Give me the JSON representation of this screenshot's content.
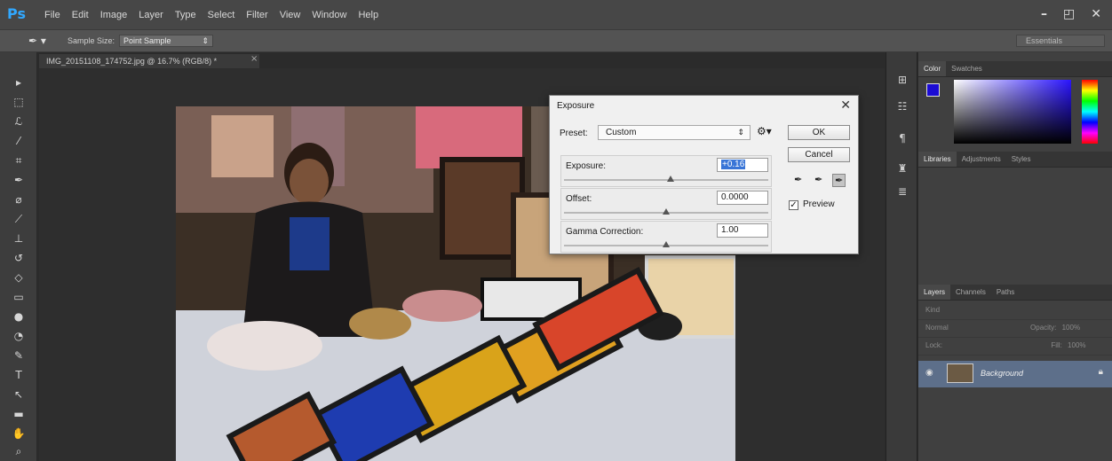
{
  "app": {
    "logo": "Ps",
    "menus": [
      "File",
      "Edit",
      "Image",
      "Layer",
      "Type",
      "Select",
      "Filter",
      "View",
      "Window",
      "Help"
    ],
    "window_controls": [
      "–",
      "◰",
      "✕"
    ]
  },
  "options_bar": {
    "tool_icon": "eyedropper-icon",
    "sample_size_label": "Sample Size:",
    "sample_size_value": "Point Sample",
    "workspace": "Essentials"
  },
  "document": {
    "tab_title": "IMG_20151108_174752.jpg @ 16.7% (RGB/8) *",
    "tab_close": "×"
  },
  "toolbar": {
    "tools": [
      "move-tool-icon",
      "marquee-tool-icon",
      "lasso-tool-icon",
      "quick-select-tool-icon",
      "crop-tool-icon",
      "eyedropper-tool-icon",
      "healing-brush-tool-icon",
      "brush-tool-icon",
      "clone-stamp-tool-icon",
      "history-brush-tool-icon",
      "eraser-tool-icon",
      "gradient-tool-icon",
      "blur-tool-icon",
      "dodge-tool-icon",
      "pen-tool-icon",
      "type-tool-icon",
      "path-select-tool-icon",
      "rectangle-tool-icon",
      "hand-tool-icon",
      "zoom-tool-icon"
    ]
  },
  "panels": {
    "color_tabs": [
      "Color",
      "Swatches"
    ],
    "library_tabs": [
      "Libraries",
      "Adjustments",
      "Styles"
    ],
    "layers_tabs": [
      "Layers",
      "Channels",
      "Paths"
    ],
    "layers_kind": "Kind",
    "blend_mode": "Normal",
    "opacity_label": "Opacity:",
    "opacity_value": "100%",
    "lock_label": "Lock:",
    "fill_label": "Fill:",
    "fill_value": "100%",
    "layer_name": "Background",
    "colors": {
      "foreground": "#1b0bd4",
      "background": "#f2f2f2"
    }
  },
  "dialog": {
    "title": "Exposure",
    "close": "✕",
    "preset_label": "Preset:",
    "preset_value": "Custom",
    "fields": [
      {
        "label": "Exposure:",
        "value": "+0.16",
        "slider": 0.52
      },
      {
        "label": "Offset:",
        "value": "0.0000",
        "slider": 0.5
      },
      {
        "label": "Gamma Correction:",
        "value": "1.00",
        "slider": 0.5
      }
    ],
    "ok_label": "OK",
    "cancel_label": "Cancel",
    "preview_label": "Preview",
    "preview_checked": true
  }
}
